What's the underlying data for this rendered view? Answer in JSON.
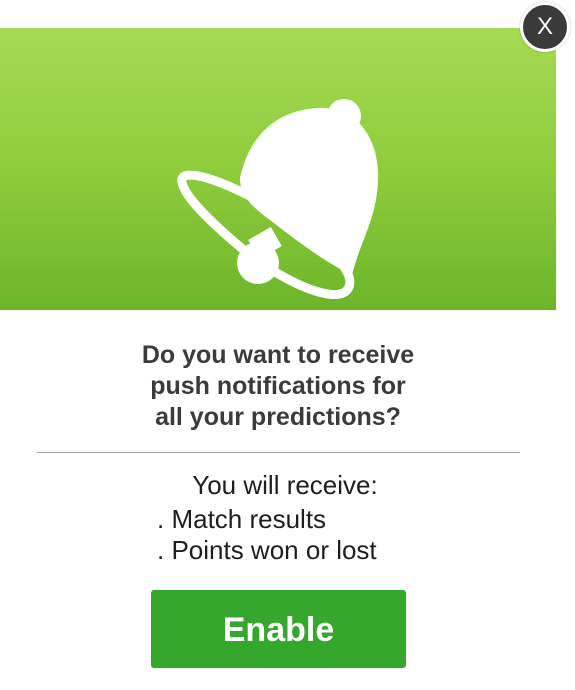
{
  "dialog": {
    "close_label": "X",
    "banner_icon": "bell-icon",
    "question_lines": [
      "Do you want to receive",
      "push notifications for",
      "all your predictions?"
    ],
    "receive_label": "You will receive:",
    "benefits": [
      ". Match results",
      ". Points won or lost"
    ],
    "enable_label": "Enable"
  },
  "colors": {
    "banner_top": "#a6da55",
    "banner_bottom": "#6db52a",
    "enable_button": "#34a72c",
    "close_button": "#3a3a3a"
  }
}
